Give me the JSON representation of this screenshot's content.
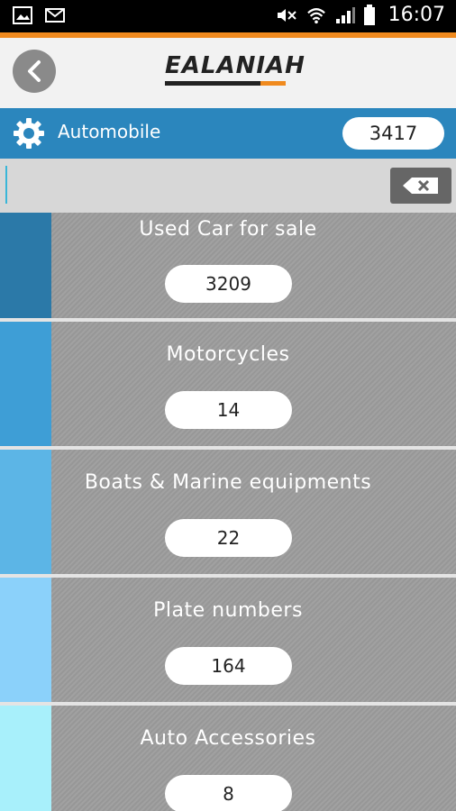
{
  "status_bar": {
    "time": "16:07",
    "icons": [
      "image-icon",
      "mail-icon",
      "mute-icon",
      "wifi-icon",
      "signal-icon",
      "battery-icon"
    ]
  },
  "header": {
    "logo_text": "EALANIAH",
    "back_icon": "chevron-left-icon"
  },
  "category": {
    "icon": "gear-icon",
    "title": "Automobile",
    "count": "3417"
  },
  "search": {
    "value": "",
    "placeholder": "",
    "clear_icon": "backspace-icon"
  },
  "items": [
    {
      "label": "Used Car for sale",
      "count": "3209",
      "color": "#2b79a8"
    },
    {
      "label": "Motorcycles",
      "count": "14",
      "color": "#3e9ed6"
    },
    {
      "label": "Boats & Marine equipments",
      "count": "22",
      "color": "#5cb5e6"
    },
    {
      "label": "Plate numbers",
      "count": "164",
      "color": "#8bd1fa"
    },
    {
      "label": "Auto Accessories",
      "count": "8",
      "color": "#a8f0fb"
    }
  ],
  "colors": {
    "accent": "#f08a1e",
    "category_bar": "#2b86bd"
  }
}
